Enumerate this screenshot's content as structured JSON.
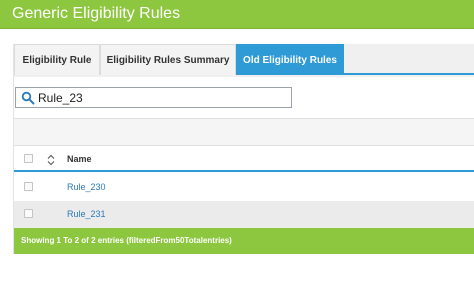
{
  "header": {
    "title": "Generic Eligibility Rules"
  },
  "tabs": [
    {
      "label": "Eligibility Rule",
      "active": false
    },
    {
      "label": "Eligibility Rules Summary",
      "active": false
    },
    {
      "label": "Old Eligibility Rules",
      "active": true
    }
  ],
  "search": {
    "value": "Rule_23",
    "icon": "search-icon"
  },
  "table": {
    "columns": [
      "Name"
    ],
    "rows": [
      {
        "name": "Rule_230"
      },
      {
        "name": "Rule_231"
      }
    ]
  },
  "footer": {
    "text": "Showing 1 To 2 of 2 entries (filteredFrom50Totalentries)"
  },
  "colors": {
    "green": "#8dc63f",
    "blue": "#2e9ad6",
    "link": "#2a7ab8"
  }
}
